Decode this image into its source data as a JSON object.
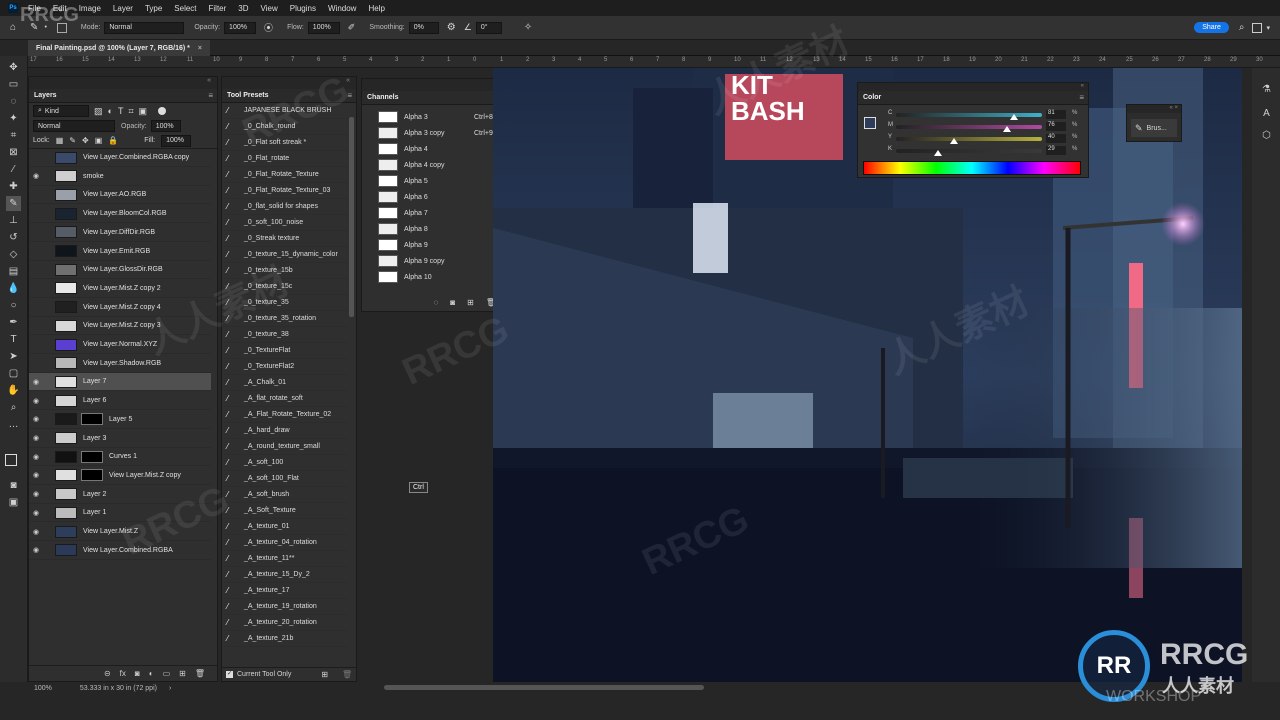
{
  "menu": [
    "File",
    "Edit",
    "Image",
    "Layer",
    "Type",
    "Select",
    "Filter",
    "3D",
    "View",
    "Plugins",
    "Window",
    "Help"
  ],
  "options": {
    "mode_label": "Mode:",
    "mode_value": "Normal",
    "opacity_label": "Opacity:",
    "opacity_value": "100%",
    "flow_label": "Flow:",
    "flow_value": "100%",
    "smoothing_label": "Smoothing:",
    "smoothing_value": "0%",
    "angle_value": "0°",
    "share_label": "Share"
  },
  "document": {
    "tab_title": "Final Painting.psd @ 100% (Layer 7, RGB/16) *",
    "close": "×"
  },
  "ruler_ticks": [
    "17",
    "16",
    "15",
    "14",
    "13",
    "12",
    "11",
    "10",
    "9",
    "8",
    "7",
    "6",
    "5",
    "4",
    "3",
    "2",
    "1",
    "0",
    "1",
    "2",
    "3",
    "4",
    "5",
    "6",
    "7",
    "8",
    "9",
    "10",
    "11",
    "12",
    "13",
    "14",
    "15",
    "16",
    "17",
    "18",
    "19",
    "20",
    "21",
    "22",
    "23",
    "24",
    "25",
    "26",
    "27",
    "28",
    "29",
    "30"
  ],
  "layers_panel": {
    "title": "Layers",
    "filter_value": "Kind",
    "blend_value": "Normal",
    "opacity_label": "Opacity:",
    "opacity_value": "100%",
    "lock_label": "Lock:",
    "fill_label": "Fill:",
    "fill_value": "100%",
    "layers": [
      {
        "name": "View Layer.Combined.RGBA copy",
        "visible": false,
        "thumb": "#3a4a6a"
      },
      {
        "name": "smoke",
        "visible": true,
        "thumb": "#cfcfcf"
      },
      {
        "name": "View Layer.AO.RGB",
        "visible": false,
        "thumb": "#9aa0aa"
      },
      {
        "name": "View Layer.BloomCol.RGB",
        "visible": false,
        "thumb": "#1a2430"
      },
      {
        "name": "View Layer.DiffDir.RGB",
        "visible": false,
        "thumb": "#555c66"
      },
      {
        "name": "View Layer.Emit.RGB",
        "visible": false,
        "thumb": "#10151c"
      },
      {
        "name": "View Layer.GlossDir.RGB",
        "visible": false,
        "thumb": "#707070"
      },
      {
        "name": "View Layer.Mist.Z copy 2",
        "visible": false,
        "thumb": "#e8e8e8"
      },
      {
        "name": "View Layer.Mist.Z copy 4",
        "visible": false,
        "thumb": "#202020"
      },
      {
        "name": "View Layer.Mist.Z copy 3",
        "visible": false,
        "thumb": "#d8d8d8"
      },
      {
        "name": "View Layer.Normal.XYZ",
        "visible": false,
        "thumb": "#5a3fd0"
      },
      {
        "name": "View Layer.Shadow.RGB",
        "visible": false,
        "thumb": "#b8b8b8"
      },
      {
        "name": "Layer 7",
        "visible": true,
        "thumb": "#e0e0e0",
        "selected": true
      },
      {
        "name": "Layer 6",
        "visible": true,
        "thumb": "#d5d5d5"
      },
      {
        "name": "Layer 5",
        "visible": true,
        "thumb": "#1a1a1a",
        "mask": true
      },
      {
        "name": "Layer 3",
        "visible": true,
        "thumb": "#cccccc"
      },
      {
        "name": "Curves 1",
        "visible": true,
        "thumb": "#111111",
        "mask": true
      },
      {
        "name": "View Layer.Mist.Z copy",
        "visible": true,
        "thumb": "#e0e0e0",
        "mask": true
      },
      {
        "name": "Layer 2",
        "visible": true,
        "thumb": "#c8c8c8"
      },
      {
        "name": "Layer 1",
        "visible": true,
        "thumb": "#bcbcbc"
      },
      {
        "name": "View Layer.Mist.Z",
        "visible": true,
        "thumb": "#2d3e5c"
      },
      {
        "name": "View Layer.Combined.RGBA",
        "visible": true,
        "thumb": "#2a3a58"
      }
    ],
    "footer_icons": [
      "link-icon",
      "fx-icon",
      "mask-icon",
      "adjustment-icon",
      "group-icon",
      "new-layer-icon",
      "trash-icon"
    ]
  },
  "tool_presets": {
    "title": "Tool Presets",
    "items": [
      "JAPANESE BLACK BRUSH",
      "_0_Chalk_round",
      "_0_Flat soft streak *",
      "_0_Flat_rotate",
      "_0_Flat_Rotate_Texture",
      "_0_Flat_Rotate_Texture_03",
      "_0_flat_solid for shapes",
      "_0_soft_100_noise",
      "_0_Streak texture",
      "_0_texture_15_dynamic_color",
      "_0_texture_15b",
      "_0_texture_15c",
      "_0_texture_35",
      "_0_texture_35_rotation",
      "_0_texture_38",
      "_0_TextureFlat",
      "_0_TextureFlat2",
      "_A_Chalk_01",
      "_A_flat_rotate_soft",
      "_A_Flat_Rotate_Texture_02",
      "_A_hard_draw",
      "_A_round_texture_small",
      "_A_soft_100",
      "_A_soft_100_Flat",
      "_A_soft_brush",
      "_A_Soft_Texture",
      "_A_texture_01",
      "_A_texture_04_rotation",
      "_A_texture_11**",
      "_A_texture_15_Dy_2",
      "_A_texture_17",
      "_A_texture_19_rotation",
      "_A_texture_20_rotation",
      "_A_texture_21b"
    ],
    "current_only": "Current Tool Only"
  },
  "channels": {
    "title": "Channels",
    "items": [
      {
        "name": "Alpha 3",
        "shortcut": "Ctrl+8"
      },
      {
        "name": "Alpha 3 copy",
        "shortcut": "Ctrl+9"
      },
      {
        "name": "Alpha 4",
        "shortcut": ""
      },
      {
        "name": "Alpha 4 copy",
        "shortcut": ""
      },
      {
        "name": "Alpha 5",
        "shortcut": ""
      },
      {
        "name": "Alpha 6",
        "shortcut": ""
      },
      {
        "name": "Alpha 7",
        "shortcut": ""
      },
      {
        "name": "Alpha 8",
        "shortcut": ""
      },
      {
        "name": "Alpha 9",
        "shortcut": ""
      },
      {
        "name": "Alpha 9 copy",
        "shortcut": ""
      },
      {
        "name": "Alpha 10",
        "shortcut": ""
      }
    ]
  },
  "color_panel": {
    "title": "Color",
    "channels": [
      {
        "label": "C",
        "value": "81",
        "unit": "%",
        "fraction": 0.81,
        "track": "#3fb1c9"
      },
      {
        "label": "M",
        "value": "76",
        "unit": "%",
        "fraction": 0.76,
        "track": "#b04aa0"
      },
      {
        "label": "Y",
        "value": "40",
        "unit": "%",
        "fraction": 0.4,
        "track": "#b8b040"
      },
      {
        "label": "K",
        "value": "29",
        "unit": "%",
        "fraction": 0.29,
        "track": "#3a3a3a"
      }
    ]
  },
  "brush_panel": {
    "label": "Brus..."
  },
  "ctrl_tooltip": "Ctrl",
  "status": {
    "zoom": "100%",
    "doc_size": "53.333 in x 30 in (72 ppi)"
  },
  "canvas_sign": {
    "line1": "KIT",
    "line2": "BASH"
  },
  "watermarks": {
    "logo": "RRCG",
    "cn": "人人素材",
    "workshop": "WORKSHOP"
  },
  "colors": {
    "accent": "#1473e6",
    "fg_swatch": "#2c3c5a",
    "bg_swatch": "#ffffff"
  }
}
